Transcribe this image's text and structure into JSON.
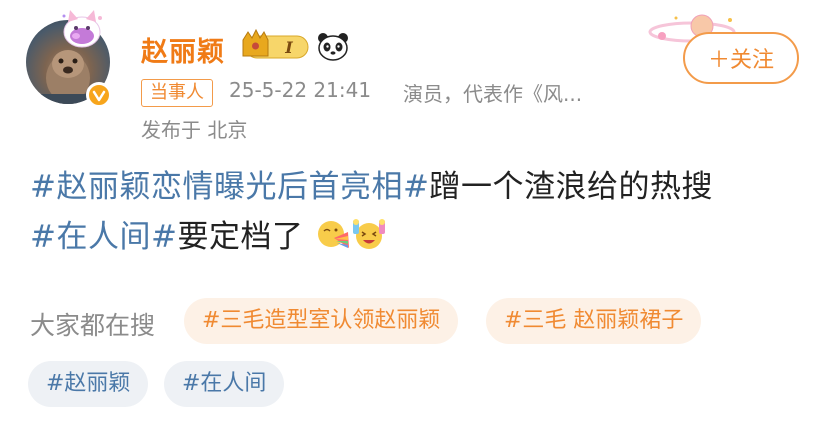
{
  "post": {
    "author": {
      "name": "赵丽颖",
      "vip_level": "I",
      "role_tag": "当事人",
      "description": "演员，代表作《风..."
    },
    "time": "25-5-22 21:41",
    "location": "发布于 北京",
    "follow_label": "＋关注",
    "content": {
      "hashtag_1": "#赵丽颖恋情曝光后首亮相#",
      "text_1": "蹭一个渣浪给的热搜",
      "hashtag_2": "#在人间#",
      "text_2": "要定档了"
    }
  },
  "searching": {
    "label": "大家都在搜",
    "chips": [
      "#三毛造型室认领赵丽颖",
      "#三毛 赵丽颖裙子"
    ]
  },
  "topics": [
    "#赵丽颖",
    "#在人间"
  ],
  "colors": {
    "accent_orange": "#f07b16",
    "hashtag_blue": "#4a78a8",
    "meta_gray": "#8b8b8b"
  },
  "icons": {
    "verified": "verified-badge-icon",
    "vip": "crown-vip-icon",
    "panda": "panda-icon",
    "emoji_1": "rainbow-vomit-emoji",
    "emoji_2": "cheering-emoji"
  }
}
